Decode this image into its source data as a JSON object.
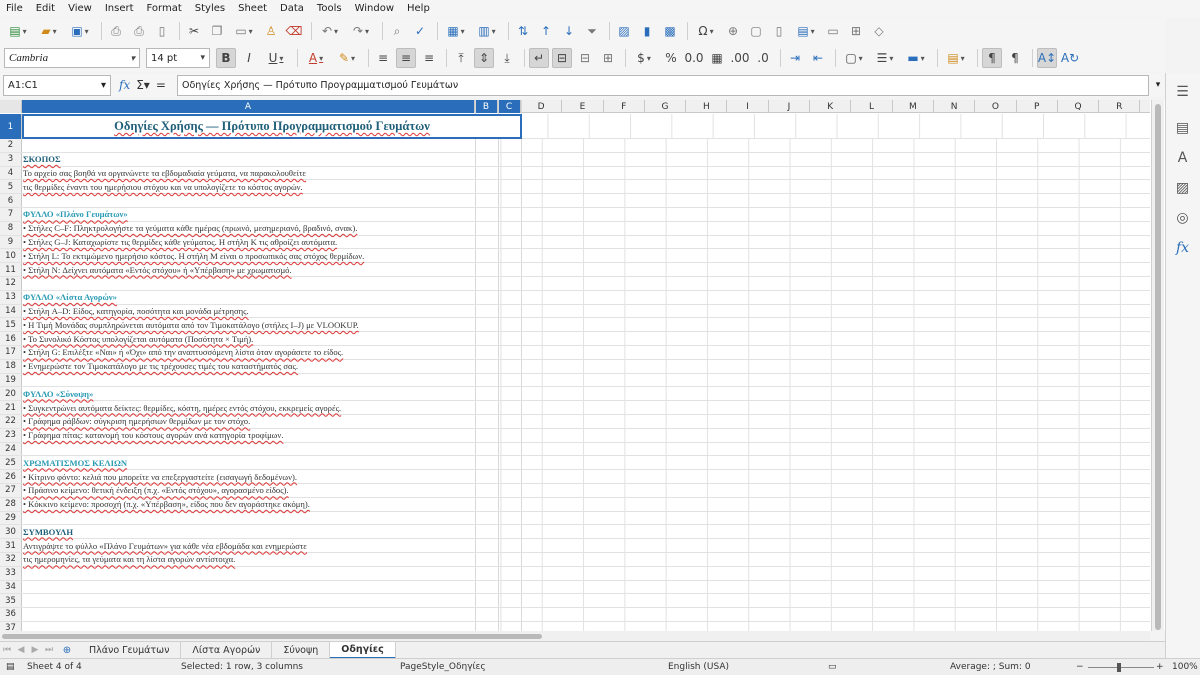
{
  "menu": [
    "File",
    "Edit",
    "View",
    "Insert",
    "Format",
    "Styles",
    "Sheet",
    "Data",
    "Tools",
    "Window",
    "Help"
  ],
  "font": {
    "name": "Cambria",
    "size": "14 pt"
  },
  "namebox": "A1:C1",
  "formula": "Οδηγίες Χρήσης — Πρότυπο Προγραμματισμού Γευμάτων",
  "columns": [
    "A",
    "B",
    "C",
    "D",
    "E",
    "F",
    "G",
    "H",
    "I",
    "J",
    "K",
    "L",
    "M",
    "N",
    "O",
    "P",
    "Q",
    "R"
  ],
  "title": "Οδηγίες Χρήσης — Πρότυπο Προγραμματισμού Γευμάτων",
  "rows": [
    {
      "n": "2",
      "text": "",
      "type": "blank"
    },
    {
      "n": "3",
      "text": "ΣΚΟΠΟΣ",
      "type": "head-dark"
    },
    {
      "n": "4",
      "text": "Το αρχείο σας βοηθά να οργανώνετε τα εβδομαδιαία γεύματα, να παρακολουθείτε",
      "type": "body"
    },
    {
      "n": "5",
      "text": "τις θερμίδες έναντι του ημερήσιου στόχου και να υπολογίζετε το κόστος αγορών.",
      "type": "body"
    },
    {
      "n": "6",
      "text": "",
      "type": "blank"
    },
    {
      "n": "7",
      "text": "ΦΥΛΛΟ «Πλάνο Γευμάτων»",
      "type": "head"
    },
    {
      "n": "8",
      "text": "• Στήλες C–F: Πληκτρολογήστε τα γεύματα κάθε ημέρας (πρωινό, μεσημεριανό, βραδινό, σνακ).",
      "type": "body"
    },
    {
      "n": "9",
      "text": "• Στήλες G–J: Καταχωρίστε τις θερμίδες κάθε γεύματος. Η στήλη K τις αθροίζει αυτόματα.",
      "type": "body"
    },
    {
      "n": "10",
      "text": "• Στήλη L: Το εκτιμώμενο ημερήσιο κόστος. Η στήλη M είναι ο προσωπικός σας στόχος θερμίδων.",
      "type": "body"
    },
    {
      "n": "11",
      "text": "• Στήλη N: Δείχνει αυτόματα «Εντός στόχου» ή «Υπέρβαση» με χρωματισμό.",
      "type": "body"
    },
    {
      "n": "12",
      "text": "",
      "type": "blank"
    },
    {
      "n": "13",
      "text": "ΦΥΛΛΟ «Λίστα Αγορών»",
      "type": "head"
    },
    {
      "n": "14",
      "text": "• Στήλη A–D: Είδος, κατηγορία, ποσότητα και μονάδα μέτρησης.",
      "type": "body"
    },
    {
      "n": "15",
      "text": "• Η Τιμή Μονάδας συμπληρώνεται αυτόματα από τον Τιμοκατάλογο (στήλες I–J) με VLOOKUP.",
      "type": "body"
    },
    {
      "n": "16",
      "text": "• Το Συνολικό Κόστος υπολογίζεται αυτόματα (Ποσότητα × Τιμή).",
      "type": "body"
    },
    {
      "n": "17",
      "text": "• Στήλη G: Επιλέξτε «Ναι» ή «Όχι» από την αναπτυσσόμενη λίστα όταν αγοράσετε το είδος.",
      "type": "body"
    },
    {
      "n": "18",
      "text": "• Ενημερώστε τον Τιμοκατάλογο με τις τρέχουσες τιμές του καταστήματός σας.",
      "type": "body"
    },
    {
      "n": "19",
      "text": "",
      "type": "blank"
    },
    {
      "n": "20",
      "text": "ΦΥΛΛΟ «Σύνοψη»",
      "type": "head"
    },
    {
      "n": "21",
      "text": "• Συγκεντρώνει αυτόματα δείκτες: θερμίδες, κόστη, ημέρες εντός στόχου, εκκρεμείς αγορές.",
      "type": "body"
    },
    {
      "n": "22",
      "text": "• Γράφημα ράβδων: σύγκριση ημερήσιων θερμίδων με τον στόχο.",
      "type": "body"
    },
    {
      "n": "23",
      "text": "• Γράφημα πίτας: κατανομή του κόστους αγορών ανά κατηγορία τροφίμων.",
      "type": "body"
    },
    {
      "n": "24",
      "text": "",
      "type": "blank"
    },
    {
      "n": "25",
      "text": "ΧΡΩΜΑΤΙΣΜΟΣ ΚΕΛΙΩΝ",
      "type": "head"
    },
    {
      "n": "26",
      "text": "• Κίτρινο φόντο: κελιά που μπορείτε να επεξεργαστείτε (εισαγωγή δεδομένων).",
      "type": "body"
    },
    {
      "n": "27",
      "text": "• Πράσινο κείμενο: θετική ένδειξη (π.χ. «Εντός στόχου», αγορασμένο είδος).",
      "type": "body"
    },
    {
      "n": "28",
      "text": "• Κόκκινο κείμενο: προσοχή (π.χ. «Υπέρβαση», είδος που δεν αγοράστηκε ακόμη).",
      "type": "body"
    },
    {
      "n": "29",
      "text": "",
      "type": "blank"
    },
    {
      "n": "30",
      "text": "ΣΥΜΒΟΥΛΗ",
      "type": "head-dark"
    },
    {
      "n": "31",
      "text": "Αντιγράψτε το φύλλο «Πλάνο Γευμάτων» για κάθε νέα εβδομάδα και ενημερώστε",
      "type": "body"
    },
    {
      "n": "32",
      "text": "τις ημερομηνίες, τα γεύματα και τη λίστα αγορών αντίστοιχα.",
      "type": "body"
    },
    {
      "n": "33",
      "text": "",
      "type": "blank"
    },
    {
      "n": "34",
      "text": "",
      "type": "blank"
    },
    {
      "n": "35",
      "text": "",
      "type": "blank"
    },
    {
      "n": "36",
      "text": "",
      "type": "blank"
    },
    {
      "n": "37",
      "text": "",
      "type": "blank"
    }
  ],
  "tabs": [
    "Πλάνο Γευμάτων",
    "Λίστα Αγορών",
    "Σύνοψη",
    "Οδηγίες"
  ],
  "active_tab": "Οδηγίες",
  "status": {
    "sheet": "Sheet 4 of 4",
    "selection": "Selected: 1 row, 3 columns",
    "pagestyle": "PageStyle_Οδηγίες",
    "language": "English (USA)",
    "stats": "Average: ; Sum: 0",
    "zoom": "100%"
  }
}
